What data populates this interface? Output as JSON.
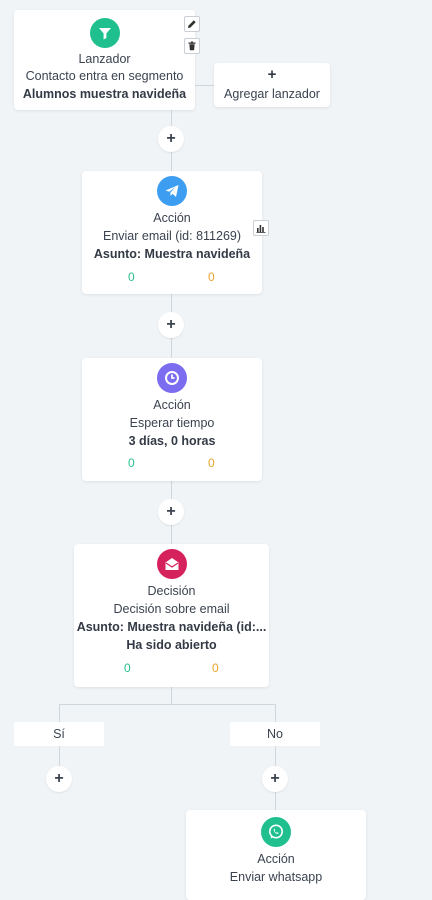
{
  "trigger": {
    "title": "Lanzador",
    "subtitle": "Contacto entra en segmento",
    "detail": "Alumnos muestra navideña",
    "icon": "filter-icon",
    "color": "#1fc08e"
  },
  "add_trigger": {
    "label": "Agregar lanzador",
    "icon": "plus-icon"
  },
  "steps": [
    {
      "title": "Acción",
      "subtitle": "Enviar email (id: 811269)",
      "detail": "Asunto: Muestra navideña",
      "stat_ok": "0",
      "stat_warn": "0",
      "icon": "paper-plane-icon",
      "color": "#3d9df0"
    },
    {
      "title": "Acción",
      "subtitle": "Esperar tiempo",
      "detail": "3 días, 0 horas",
      "stat_ok": "0",
      "stat_warn": "0",
      "icon": "clock-icon",
      "color": "#7b6cf0"
    },
    {
      "title": "Decisión",
      "subtitle": "Decisión sobre email",
      "detail": "Asunto: Muestra navideña (id:...",
      "detail2": "Ha sido abierto",
      "stat_ok": "0",
      "stat_warn": "0",
      "icon": "open-envelope-icon",
      "color": "#d6225c"
    },
    {
      "title": "Acción",
      "subtitle": "Enviar whatsapp",
      "icon": "whatsapp-icon",
      "color": "#1fc08e"
    }
  ],
  "branches": {
    "yes": "Sí",
    "no": "No"
  },
  "add_step_symbol": "+"
}
